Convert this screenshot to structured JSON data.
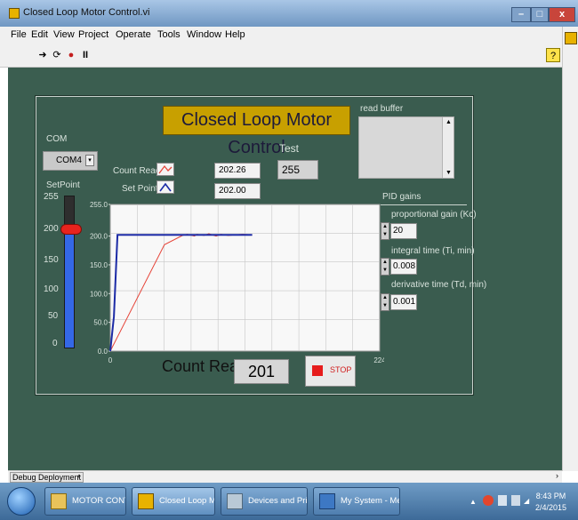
{
  "window": {
    "title": "Closed Loop Motor Control.vi",
    "min": "–",
    "max": "□",
    "close": "x"
  },
  "menu": [
    "File",
    "Edit",
    "View",
    "Project",
    "Operate",
    "Tools",
    "Window",
    "Help"
  ],
  "toolbar": {
    "run": "➜",
    "run_cont": "⟳",
    "abort": "●",
    "pause": "II",
    "help": "?"
  },
  "panel": {
    "title": "Closed Loop Motor Control",
    "read_buffer_label": "read buffer",
    "com_label": "COM",
    "com_value": "COM4",
    "setpoint_label": "SetPoint",
    "setpoint_value": 203,
    "slider_ticks": [
      "255",
      "200",
      "150",
      "100",
      "50",
      "0"
    ],
    "legend": {
      "count_read": "Count Read",
      "set_point": "Set Point"
    },
    "count_read_indicator": "202.26",
    "set_point_indicator": "202.00",
    "test_label": "Test",
    "test_value": "255",
    "pid_label": "PID gains",
    "kc_label": "proportional gain (Kc)",
    "kc_value": "20",
    "ti_label": "integral time (Ti, min)",
    "ti_value": "0.008",
    "td_label": "derivative time (Td, min)",
    "td_value": "0.001",
    "count_read_big_label": "Count Read",
    "count_read_big_value": "201",
    "stop_label": "STOP"
  },
  "chart_data": {
    "type": "line",
    "xlim": [
      0,
      224
    ],
    "ylim": [
      0,
      255
    ],
    "x_ticks": [
      "0",
      "224"
    ],
    "y_ticks": [
      "255.0",
      "200.0",
      "150.0",
      "100.0",
      "50.0",
      "0.0"
    ],
    "grid": true,
    "series": [
      {
        "name": "Count Read",
        "color": "#e6453a",
        "x": [
          0,
          45,
          60,
          64,
          70,
          72,
          78,
          82,
          88,
          92,
          98,
          104,
          110,
          118
        ],
        "y": [
          0,
          185,
          201,
          203,
          200,
          203,
          201,
          204,
          200,
          203,
          201,
          202,
          203,
          202
        ]
      },
      {
        "name": "Set Point",
        "color": "#1c2ba6",
        "x": [
          0,
          3,
          6,
          118
        ],
        "y": [
          0,
          60,
          202,
          202
        ]
      }
    ]
  },
  "status": {
    "debug_label": "Debug Deployment"
  },
  "taskbar": {
    "items": [
      "MOTOR CONTROL",
      "Closed Loop Mot...",
      "Devices and Print...",
      "My System - Mea..."
    ],
    "time": "8:43 PM",
    "date": "2/4/2015"
  }
}
